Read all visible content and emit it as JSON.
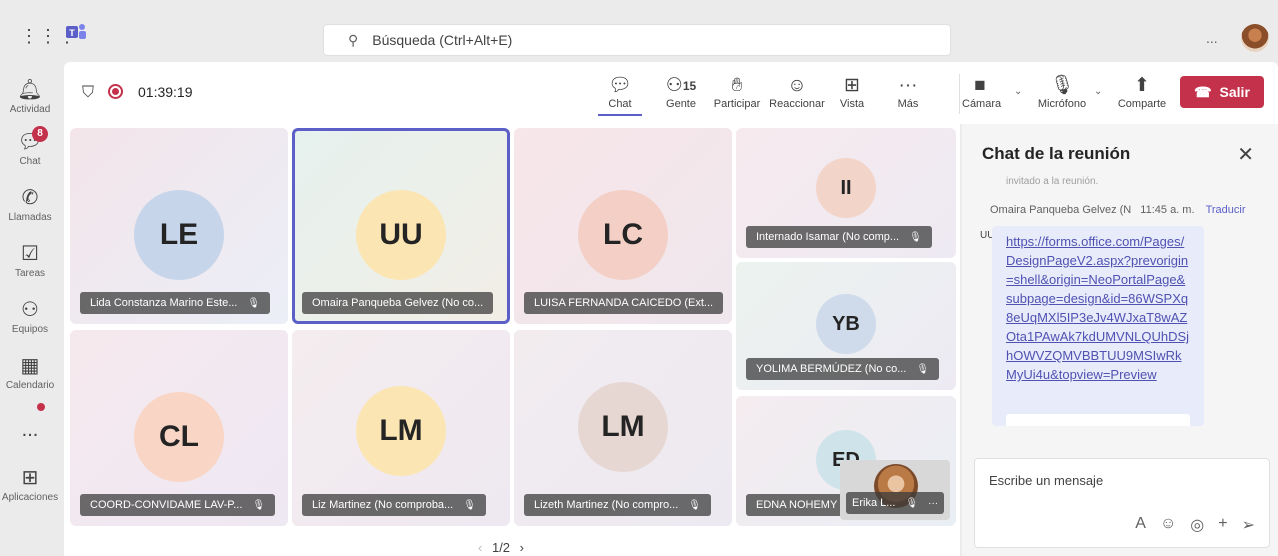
{
  "topbar": {
    "search_placeholder": "Búsqueda (Ctrl+Alt+E)",
    "more": "..."
  },
  "rail": {
    "items": [
      {
        "label": "Actividad",
        "icon": "bell-icon"
      },
      {
        "label": "Chat",
        "icon": "chat-icon",
        "badge": "8"
      },
      {
        "label": "Llamadas",
        "icon": "phone-icon"
      },
      {
        "label": "Tareas",
        "icon": "tasks-icon"
      },
      {
        "label": "Equipos",
        "icon": "teams-icon"
      },
      {
        "label": "Calendario",
        "icon": "calendar-icon"
      },
      {
        "label": "...",
        "icon": "more-icon"
      },
      {
        "label": "Aplicaciones",
        "icon": "apps-icon"
      }
    ]
  },
  "meeting": {
    "timer": "01:39:19",
    "tools": {
      "chat": "Chat",
      "people": "Gente",
      "people_count": "15",
      "raise": "Participar",
      "react": "Reaccionar",
      "view": "Vista",
      "more": "Más",
      "camera": "Cámara",
      "mic": "Micrófono",
      "share": "Comparte",
      "leave": "Salir"
    }
  },
  "tiles": [
    {
      "initials": "LE",
      "name": "Lida Constanza Marino Este..."
    },
    {
      "initials": "UU",
      "name": "Omaira Panqueba Gelvez (No co..."
    },
    {
      "initials": "LC",
      "name": "LUISA FERNANDA CAICEDO (Ext..."
    },
    {
      "initials": "CL",
      "name": "COORD-CONVIDAME LAV-P..."
    },
    {
      "initials": "LM",
      "name": "Liz Martinez (No comproba..."
    },
    {
      "initials": "LM",
      "name": "Lizeth Martinez (No compro..."
    },
    {
      "initials": "II",
      "name": "Internado Isamar (No comp..."
    },
    {
      "initials": "YB",
      "name": "YOLIMA BERMÚDEZ (No co..."
    },
    {
      "initials": "ED",
      "name": "EDNA NOHEMY"
    }
  ],
  "self_view": {
    "name": "Erika L..."
  },
  "pager": {
    "text": "1/2"
  },
  "chat": {
    "title": "Chat de la reunión",
    "faded_text": "invitado a la reunión.",
    "sender": "Omaira Panqueba Gelvez (N",
    "time": "11:45 a. m.",
    "translate": "Traducir",
    "avatar": "UU",
    "link": "https://forms.office.com/Pages/DesignPageV2.aspx?prevorigin=shell&origin=NeoPortalPage&subpage=design&id=86WSPXq8eUqMXl5IP3eJv4WJxaT8wAZOta1PAwAk7kdUMVNLQUhDSjhOWVZQMVBBTUU9MSIwRkMyUi4u&topview=Preview",
    "input_placeholder": "Escribe un mensaje"
  },
  "colors": {
    "accent": "#5b5fc7",
    "leave": "#c4314b"
  }
}
